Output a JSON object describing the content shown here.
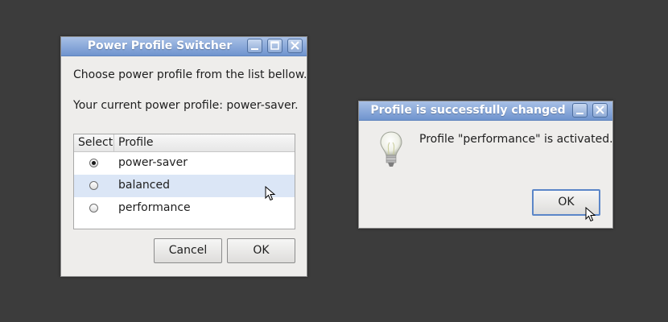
{
  "desktop": {
    "background": "#3c3c3c"
  },
  "switcher": {
    "title": "Power Profile Switcher",
    "instruction": "Choose power profile from the list bellow.",
    "current_profile": "Your current power profile: power-saver.",
    "columns": {
      "select": "Select",
      "profile": "Profile"
    },
    "profiles": [
      {
        "name": "power-saver",
        "selected": true
      },
      {
        "name": "balanced",
        "selected": false
      },
      {
        "name": "performance",
        "selected": false
      }
    ],
    "cancel_label": "Cancel",
    "ok_label": "OK"
  },
  "notice": {
    "title": "Profile is successfully changed",
    "message": "Profile \"performance\" is activated.",
    "icon": "lightbulb-icon",
    "ok_label": "OK"
  },
  "colors": {
    "titlebar": "#7f9fd6",
    "highlight": "#dbe6f6",
    "default_button_border": "#5b86c8"
  }
}
